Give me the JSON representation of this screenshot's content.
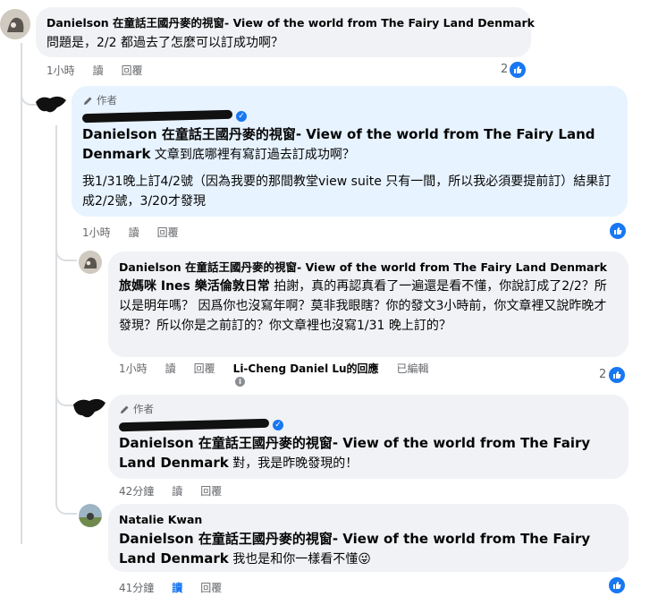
{
  "comments": [
    {
      "name": "Danielson 在童話王國丹麥的視窗- View of the world from The Fairy Land Denmark",
      "text": "問題是，2/2 都過去了怎麼可以訂成功啊？",
      "time": "1小時",
      "read": "讀",
      "reply": "回覆",
      "likes": "2"
    },
    {
      "author_tag": "作者",
      "mention": "Danielson 在童話王國丹麥的視窗- View of the world from The Fairy Land Denmark",
      "text": " 文章到底哪裡有寫訂過去訂成功啊？",
      "text2": "我1/31晚上訂4/2號（因為我要的那間教堂view suite 只有一間，所以我必須要提前訂）結果訂成2/2號，3/20才發現",
      "time": "1小時",
      "read": "讀",
      "reply": "回覆"
    },
    {
      "name": "Danielson 在童話王國丹麥的視窗- View of the world from The Fairy Land Denmark",
      "mention": "旅媽咪 Ines 樂活倫敦日常",
      "text": " 拍謝，真的再認真看了一遍還是看不懂，你說訂成了2/2？所以是明年嗎？ 因爲你也沒寫年啊？莫非我眼瞎？你的發文3小時前，你文章裡又說昨晚才發現？所以你是之前訂的？你文章裡也沒寫1/31 晚上訂的？",
      "time": "1小時",
      "read": "讀",
      "reply": "回覆",
      "replied_to": "Li-Cheng Daniel Lu的回應",
      "edited": "已編輯",
      "likes": "2"
    },
    {
      "author_tag": "作者",
      "mention": "Danielson 在童話王國丹麥的視窗- View of the world from The Fairy Land Denmark",
      "text": " 對，我是昨晚發現的！",
      "time": "42分鐘",
      "read": "讀",
      "reply": "回覆"
    },
    {
      "name": "Natalie Kwan",
      "mention": "Danielson 在童話王國丹麥的視窗- View of the world from The Fairy Land Denmark",
      "text": " 我也是和你一樣看不懂😜",
      "time": "41分鐘",
      "read": "讀",
      "reply": "回覆"
    }
  ],
  "colors": {
    "like_blue": "#1877f2",
    "bubble_grey": "#f0f2f5",
    "author_blue": "#e7f3ff"
  }
}
